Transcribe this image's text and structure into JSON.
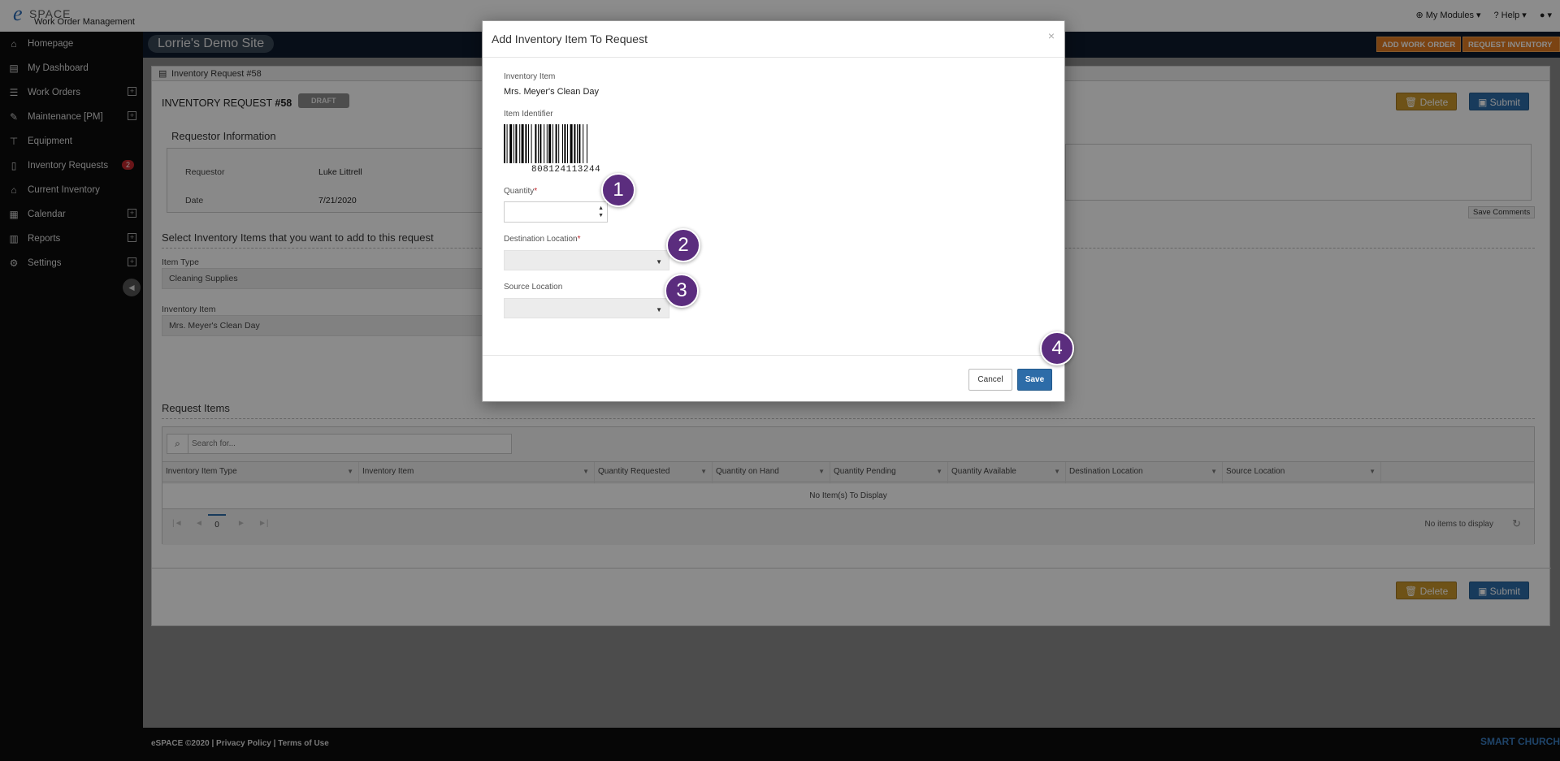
{
  "app": {
    "logo_e": "e",
    "logo_space": "SPACE",
    "logo_subtitle": "Work Order Management"
  },
  "topbar": {
    "my_modules": "My Modules",
    "help": "Help",
    "user_icon": "user-icon"
  },
  "header": {
    "site_name": "Lorrie's Demo Site",
    "add_work_order": "ADD WORK ORDER",
    "request_inventory": "REQUEST INVENTORY"
  },
  "sidebar": {
    "items": [
      {
        "label": "Homepage",
        "icon": "home-icon",
        "expandable": false
      },
      {
        "label": "My Dashboard",
        "icon": "dashboard-icon",
        "expandable": false
      },
      {
        "label": "Work Orders",
        "icon": "table-icon",
        "expandable": true
      },
      {
        "label": "Maintenance [PM]",
        "icon": "wrench-icon",
        "expandable": true
      },
      {
        "label": "Equipment",
        "icon": "equipment-icon",
        "expandable": false
      },
      {
        "label": "Inventory Requests",
        "icon": "document-icon",
        "expandable": false,
        "badge": "2"
      },
      {
        "label": "Current Inventory",
        "icon": "bank-icon",
        "expandable": false
      },
      {
        "label": "Calendar",
        "icon": "calendar-icon",
        "expandable": true
      },
      {
        "label": "Reports",
        "icon": "reports-icon",
        "expandable": true
      },
      {
        "label": "Settings",
        "icon": "gear-icon",
        "expandable": true
      }
    ]
  },
  "page": {
    "breadcrumb": "Inventory Request #58",
    "title_prefix": "INVENTORY REQUEST ",
    "title_number": "#58",
    "status_badge": "DRAFT",
    "delete_label": "Delete",
    "submit_label": "Submit",
    "save_comments": "Save Comments",
    "requestor_section": "Requestor Information",
    "requestor_label": "Requestor",
    "requestor_value": "Luke Littrell",
    "date_label": "Date",
    "date_value": "7/21/2020",
    "select_section": "Select Inventory Items that you want to add to this request",
    "item_type_label": "Item Type",
    "item_type_value": "Cleaning Supplies",
    "inventory_item_label": "Inventory Item",
    "inventory_item_value": "Mrs. Meyer's Clean Day",
    "request_items_section": "Request Items"
  },
  "grid": {
    "search_placeholder": "Search for...",
    "columns": [
      "Inventory Item Type",
      "Inventory Item",
      "Quantity Requested",
      "Quantity on Hand",
      "Quantity Pending",
      "Quantity Available",
      "Destination Location",
      "Source Location"
    ],
    "empty_text": "No Item(s) To Display",
    "page_number": "0",
    "no_items_text": "No items to display"
  },
  "modal": {
    "title": "Add Inventory Item To Request",
    "close": "×",
    "inventory_item_label": "Inventory Item",
    "inventory_item_value": "Mrs. Meyer's Clean Day",
    "item_identifier_label": "Item Identifier",
    "barcode_number": "808124113244",
    "quantity_label": "Quantity",
    "required_mark": "*",
    "destination_label": "Destination Location",
    "source_label": "Source Location",
    "cancel_label": "Cancel",
    "save_label": "Save"
  },
  "markers": [
    "1",
    "2",
    "3",
    "4"
  ],
  "footer": {
    "copyright": "eSPACE ©2020 | Privacy Policy | Terms of Use",
    "brand": "SMART CHURCH"
  },
  "colors": {
    "accent_orange": "#e07b21",
    "primary_blue": "#2d6ca8",
    "delete_gold": "#c9962b",
    "marker_purple": "#5b2d7e",
    "badge_red": "#c0272d"
  }
}
